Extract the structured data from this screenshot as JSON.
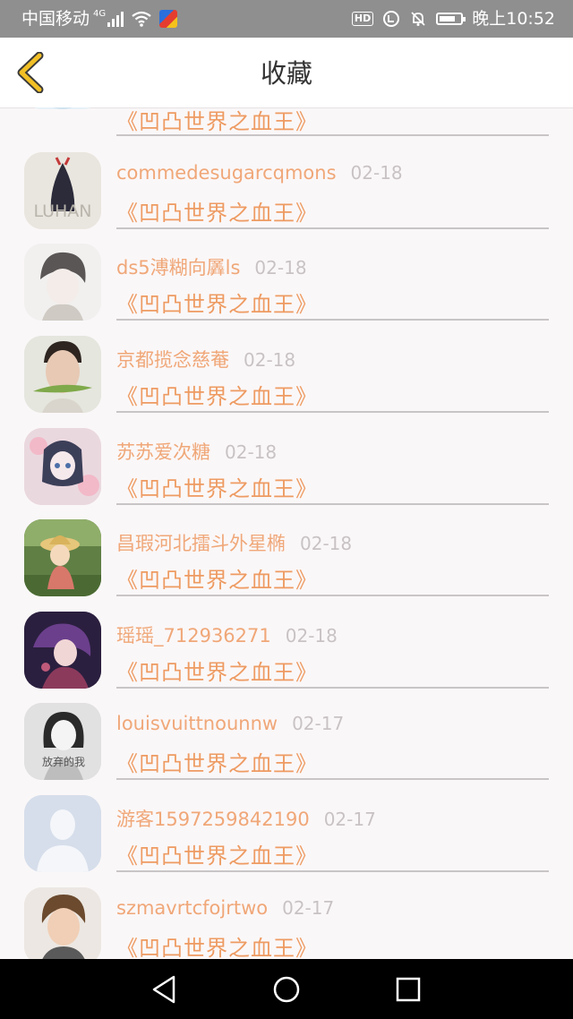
{
  "status_bar": {
    "carrier": "中国移动",
    "network": "4G",
    "hd": "HD",
    "time": "晚上10:52"
  },
  "header": {
    "title": "收藏",
    "back_icon": "chevron-left-icon"
  },
  "favorites": [
    {
      "user": "",
      "date": "",
      "work": "《凹凸世界之血王》"
    },
    {
      "user": "commedesugarcqmons",
      "date": "02-18",
      "work": "《凹凸世界之血王》"
    },
    {
      "user": "ds5溥糊向羼ls",
      "date": "02-18",
      "work": "《凹凸世界之血王》"
    },
    {
      "user": "京都揽念慈菴",
      "date": "02-18",
      "work": "《凹凸世界之血王》"
    },
    {
      "user": "苏苏爱次糖",
      "date": "02-18",
      "work": "《凹凸世界之血王》"
    },
    {
      "user": "昌瑕河北擂斗外星椭",
      "date": "02-18",
      "work": "《凹凸世界之血王》"
    },
    {
      "user": "瑶瑶_712936271",
      "date": "02-18",
      "work": "《凹凸世界之血王》"
    },
    {
      "user": "louisvuittnounnw",
      "date": "02-17",
      "work": "《凹凸世界之血王》"
    },
    {
      "user": "游客1597259842190",
      "date": "02-17",
      "work": "《凹凸世界之血王》"
    },
    {
      "user": "szmavrtcfojrtwo",
      "date": "02-17",
      "work": "《凹凸世界之血王》"
    }
  ],
  "avatar_text": {
    "luhan": "LUHAN",
    "sketch": "放弃的我"
  },
  "colors": {
    "accent_orange": "#ee9b62",
    "back_arrow": "#f2c026",
    "date_gray": "#c8c2c4"
  },
  "nav_icons": [
    "back-triangle-icon",
    "home-circle-icon",
    "recents-square-icon"
  ]
}
